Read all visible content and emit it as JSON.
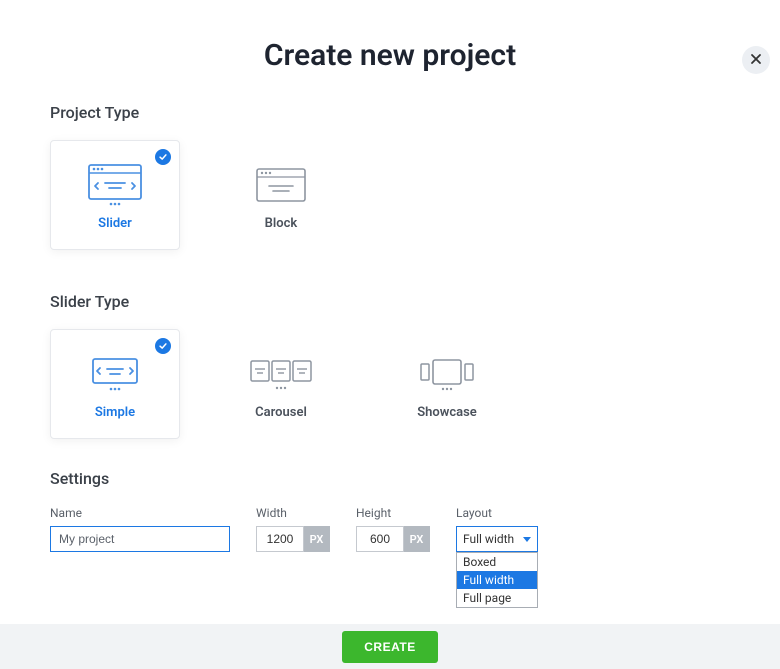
{
  "title": "Create new project",
  "sections": {
    "projectType": {
      "label": "Project Type",
      "options": {
        "slider": "Slider",
        "block": "Block"
      },
      "selected": "slider"
    },
    "sliderType": {
      "label": "Slider Type",
      "options": {
        "simple": "Simple",
        "carousel": "Carousel",
        "showcase": "Showcase"
      },
      "selected": "simple"
    },
    "settings": {
      "label": "Settings",
      "name": {
        "label": "Name",
        "value": "My project"
      },
      "width": {
        "label": "Width",
        "value": "1200",
        "unit": "PX"
      },
      "height": {
        "label": "Height",
        "value": "600",
        "unit": "PX"
      },
      "layout": {
        "label": "Layout",
        "value": "Full width",
        "options": [
          "Boxed",
          "Full width",
          "Full page"
        ],
        "highlighted": "Full width"
      }
    }
  },
  "footer": {
    "create": "CREATE"
  }
}
